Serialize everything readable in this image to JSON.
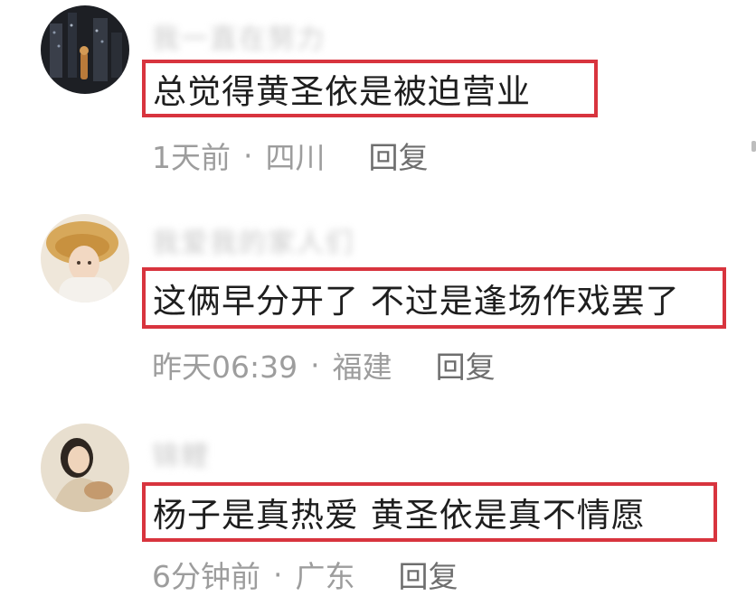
{
  "comments": [
    {
      "username": "我一直在努力",
      "text": "总觉得黄圣依是被迫营业",
      "time": "1天前",
      "location": "四川",
      "reply_label": "回复",
      "avatar_icon": "avatar-dark-city-icon"
    },
    {
      "username": "我爱我的家人们",
      "text": "这俩早分开了 不过是逢场作戏罢了",
      "time": "昨天06:39",
      "location": "福建",
      "reply_label": "回复",
      "avatar_icon": "avatar-straw-hat-icon"
    },
    {
      "username": "锦鲤",
      "text": "杨子是真热爱  黄圣依是真不情愿",
      "time": "6分钟前",
      "location": "广东",
      "reply_label": "回复",
      "avatar_icon": "avatar-woman-portrait-icon"
    }
  ],
  "colors": {
    "highlight_border": "#d8343e",
    "meta_text": "#9d9d9d",
    "content_text": "#1e1e1e"
  }
}
